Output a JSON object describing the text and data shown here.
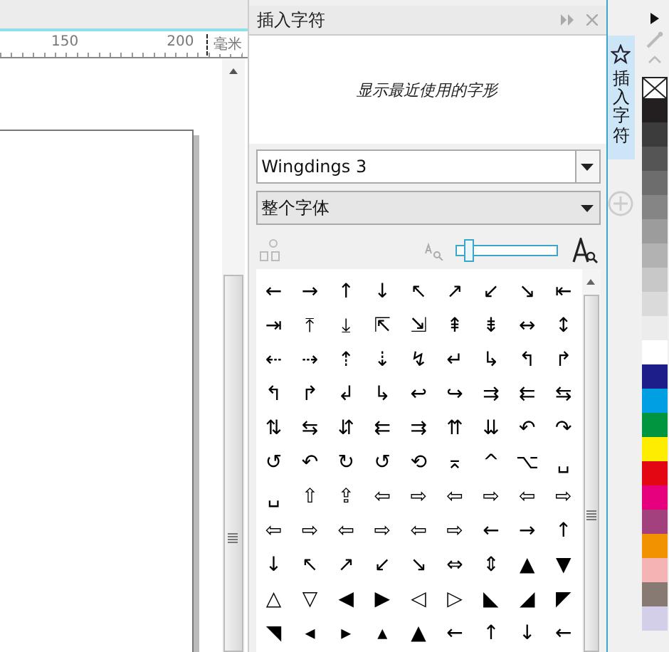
{
  "ruler": {
    "labels": [
      "150",
      "200"
    ],
    "unit": "毫米"
  },
  "docker": {
    "title": "插入字符",
    "preview_hint": "显示最近使用的字形",
    "font": "Wingdings 3",
    "subset": "整个字体",
    "zoom": {
      "level": 0.08
    },
    "glyphs": [
      "←",
      "→",
      "↑",
      "↓",
      "↖",
      "↗",
      "↙",
      "↘",
      "⇤",
      "⇥",
      "⤒",
      "⤓",
      "⇱",
      "⇲",
      "⇞",
      "⇟",
      "↔",
      "↕",
      "⇠",
      "⇢",
      "⇡",
      "⇣",
      "↯",
      "↵",
      "↳",
      "↰",
      "↱",
      "↰",
      "↱",
      "↲",
      "↳",
      "↩",
      "↪",
      "⇉",
      "⇇",
      "⇆",
      "⇅",
      "⇆",
      "⇵",
      "⇇",
      "⇉",
      "⇈",
      "⇊",
      "↶",
      "↷",
      "↺",
      "↶",
      "↻",
      "↺",
      "⟲",
      "⌅",
      "^",
      "⌥",
      "␣",
      "␣",
      "⇧",
      "⇪",
      "⇦",
      "⇨",
      "⇦",
      "⇨",
      "⇦",
      "⇨",
      "⇦",
      "⇨",
      "⇦",
      "⇨",
      "⇦",
      "⇨",
      "←",
      "→",
      "↑",
      "↓",
      "↖",
      "↗",
      "↙",
      "↘",
      "⇔",
      "⇕",
      "▲",
      "▼",
      "△",
      "▽",
      "◀",
      "▶",
      "◁",
      "▷",
      "◣",
      "◢",
      "◤",
      "◥",
      "◂",
      "▸",
      "▴",
      "▲",
      "←",
      "↑",
      "↓",
      "←"
    ]
  },
  "side_tab": {
    "label": "插入字符",
    "selected": true
  },
  "palette": {
    "swatches": [
      {
        "kind": "none"
      },
      {
        "kind": "color",
        "color": "#231f20"
      },
      {
        "kind": "color",
        "color": "#3c3c3c"
      },
      {
        "kind": "color",
        "color": "#555555"
      },
      {
        "kind": "color",
        "color": "#6d6d6d"
      },
      {
        "kind": "color",
        "color": "#858585"
      },
      {
        "kind": "color",
        "color": "#9c9c9c"
      },
      {
        "kind": "color",
        "color": "#b2b2b2"
      },
      {
        "kind": "color",
        "color": "#c8c8c8"
      },
      {
        "kind": "color",
        "color": "#dadada"
      },
      {
        "kind": "color",
        "color": "#ececec"
      },
      {
        "kind": "color",
        "color": "#ffffff"
      },
      {
        "kind": "color",
        "color": "#1d1e8a"
      },
      {
        "kind": "color",
        "color": "#009fe3"
      },
      {
        "kind": "color",
        "color": "#009640"
      },
      {
        "kind": "color",
        "color": "#ffed00"
      },
      {
        "kind": "color",
        "color": "#e30613"
      },
      {
        "kind": "color",
        "color": "#e6007e"
      },
      {
        "kind": "color",
        "color": "#a3417f"
      },
      {
        "kind": "color",
        "color": "#f39200"
      },
      {
        "kind": "color",
        "color": "#f5b3b4"
      },
      {
        "kind": "color",
        "color": "#877a73"
      },
      {
        "kind": "color",
        "color": "#d3cfe8"
      }
    ]
  }
}
